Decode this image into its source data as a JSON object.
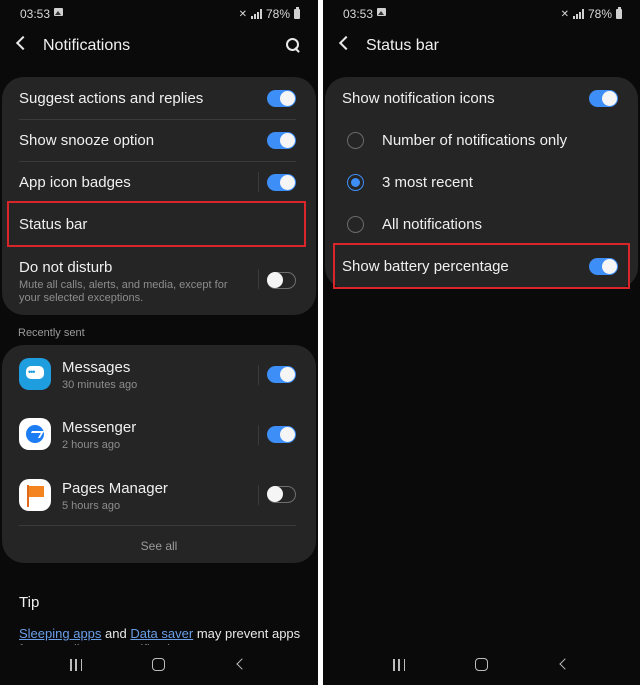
{
  "left": {
    "statusbar": {
      "time": "03:53",
      "battery": "78%"
    },
    "appbar": {
      "title": "Notifications"
    },
    "settings": [
      {
        "label": "Suggest actions and replies",
        "toggle": "on"
      },
      {
        "label": "Show snooze option",
        "toggle": "on"
      },
      {
        "label": "App icon badges",
        "toggle": "on"
      },
      {
        "label": "Status bar"
      },
      {
        "label": "Do not disturb",
        "sub": "Mute all calls, alerts, and media, except for your selected exceptions.",
        "toggle": "off"
      }
    ],
    "recently_sent_label": "Recently sent",
    "apps": [
      {
        "name": "Messages",
        "time": "30 minutes ago",
        "icon": "messages-icon",
        "toggle": "on"
      },
      {
        "name": "Messenger",
        "time": "2 hours ago",
        "icon": "messenger-icon",
        "toggle": "on"
      },
      {
        "name": "Pages Manager",
        "time": "5 hours ago",
        "icon": "pages-manager-icon",
        "toggle": "off"
      }
    ],
    "see_all": "See all",
    "tip": {
      "title": "Tip",
      "link1": "Sleeping apps",
      "and": " and ",
      "link2": "Data saver",
      "rest": " may prevent apps from sending you notifications. Turn"
    }
  },
  "right": {
    "statusbar": {
      "time": "03:53",
      "battery": "78%"
    },
    "appbar": {
      "title": "Status bar"
    },
    "show_icons": {
      "label": "Show notification icons",
      "toggle": "on"
    },
    "radio_options": [
      {
        "label": "Number of notifications only",
        "checked": false
      },
      {
        "label": "3 most recent",
        "checked": true
      },
      {
        "label": "All notifications",
        "checked": false
      }
    ],
    "battery_pct": {
      "label": "Show battery percentage",
      "toggle": "on"
    }
  },
  "colors": {
    "accent": "#3e8ef7",
    "highlight": "#d9262b",
    "card": "#252525",
    "background": "#0a0a0a"
  }
}
